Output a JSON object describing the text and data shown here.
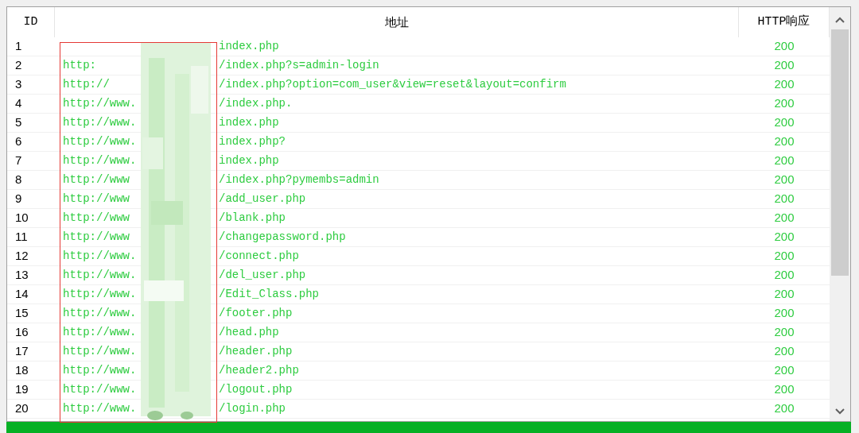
{
  "table": {
    "columns": [
      "ID",
      "地址",
      "HTTP响应"
    ],
    "rows": [
      {
        "id": "1",
        "url_start": "",
        "url_end": "index.php",
        "http": "200"
      },
      {
        "id": "2",
        "url_start": "http:",
        "url_end": "/index.php?s=admin-login",
        "http": "200"
      },
      {
        "id": "3",
        "url_start": "http://",
        "url_end": "/index.php?option=com_user&view=reset&layout=confirm",
        "http": "200"
      },
      {
        "id": "4",
        "url_start": "http://www.",
        "url_end": "/index.php.",
        "http": "200"
      },
      {
        "id": "5",
        "url_start": "http://www.",
        "url_end": "index.php",
        "http": "200"
      },
      {
        "id": "6",
        "url_start": "http://www.",
        "url_end": "index.php?",
        "http": "200"
      },
      {
        "id": "7",
        "url_start": "http://www.",
        "url_end": "index.php",
        "http": "200"
      },
      {
        "id": "8",
        "url_start": "http://www",
        "url_end": "/index.php?pymembs=admin",
        "http": "200"
      },
      {
        "id": "9",
        "url_start": "http://www",
        "url_end": "/add_user.php",
        "http": "200"
      },
      {
        "id": "10",
        "url_start": "http://www",
        "url_end": "/blank.php",
        "http": "200"
      },
      {
        "id": "11",
        "url_start": "http://www",
        "url_end": "/changepassword.php",
        "http": "200"
      },
      {
        "id": "12",
        "url_start": "http://www.",
        "url_end": "/connect.php",
        "http": "200"
      },
      {
        "id": "13",
        "url_start": "http://www.",
        "url_end": "/del_user.php",
        "http": "200"
      },
      {
        "id": "14",
        "url_start": "http://www.",
        "url_end": "/Edit_Class.php",
        "http": "200"
      },
      {
        "id": "15",
        "url_start": "http://www.",
        "url_end": "/footer.php",
        "http": "200"
      },
      {
        "id": "16",
        "url_start": "http://www.",
        "url_end": "/head.php",
        "http": "200"
      },
      {
        "id": "17",
        "url_start": "http://www.",
        "url_end": "/header.php",
        "http": "200"
      },
      {
        "id": "18",
        "url_start": "http://www.",
        "url_end": "/header2.php",
        "http": "200"
      },
      {
        "id": "19",
        "url_start": "http://www.",
        "url_end": "/logout.php",
        "http": "200"
      },
      {
        "id": "20",
        "url_start": "http://www.",
        "url_end": "/login.php",
        "http": "200"
      }
    ]
  },
  "progress": {
    "level": 1
  }
}
